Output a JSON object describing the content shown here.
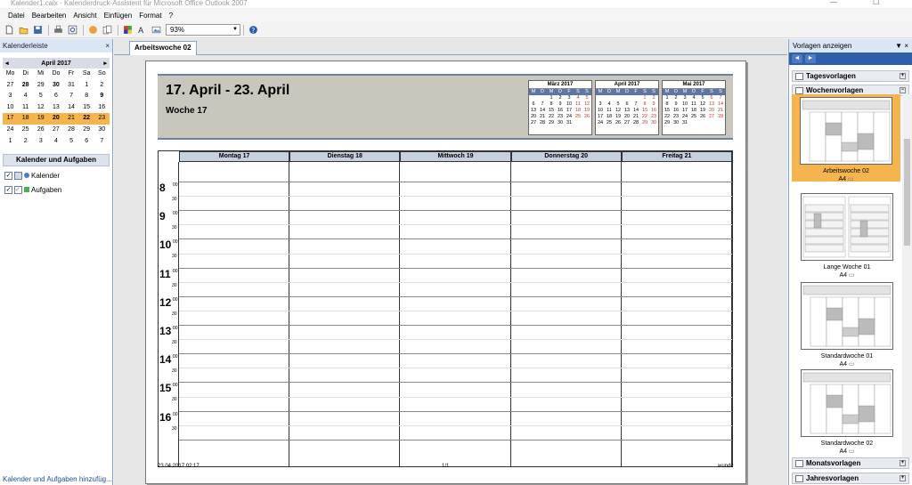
{
  "title": "Kalender1.calx - Kalenderdruck-Assistent für Microsoft Office Outlook 2007",
  "window_controls": {
    "minimize": "—",
    "maximize": "☐"
  },
  "menu": [
    "Datei",
    "Bearbeiten",
    "Ansicht",
    "Einfügen",
    "Format",
    "?"
  ],
  "toolbar": {
    "zoom": "93%"
  },
  "left_pane": {
    "title": "Kalenderleiste",
    "close": "×",
    "mini_cal": {
      "prev": "◂",
      "next": "▸",
      "month": "April 2017",
      "weekdays": [
        "Mo",
        "Di",
        "Mi",
        "Do",
        "Fr",
        "Sa",
        "So"
      ],
      "weeks": [
        [
          "27",
          "28",
          "29",
          "30",
          "31",
          "1",
          "2"
        ],
        [
          "3",
          "4",
          "5",
          "6",
          "7",
          "8",
          "9"
        ],
        [
          "10",
          "11",
          "12",
          "13",
          "14",
          "15",
          "16"
        ],
        [
          "17",
          "18",
          "19",
          "20",
          "21",
          "22",
          "23"
        ],
        [
          "24",
          "25",
          "26",
          "27",
          "28",
          "29",
          "30"
        ],
        [
          "1",
          "2",
          "3",
          "4",
          "5",
          "6",
          "7"
        ]
      ],
      "highlight_week": 3
    },
    "group_title": "Kalender und Aufgaben",
    "items": [
      {
        "label": "Kalender",
        "checked": true,
        "color": "#4a7bd0"
      },
      {
        "label": "Aufgaben",
        "checked": true,
        "color": "#4fae4f"
      }
    ],
    "footer_link": "Kalender und Aufgaben hinzufüg..."
  },
  "main": {
    "tab": "Arbeitswoche 02",
    "page": {
      "title": "17. April - 23. April",
      "subtitle": "Woche 17",
      "mini_months": [
        {
          "title": "März 2017",
          "header": [
            "M",
            "D",
            "M",
            "D",
            "F",
            "S",
            "S"
          ],
          "weeks": [
            [
              "",
              "",
              "1",
              "2",
              "3",
              "4",
              "5"
            ],
            [
              "6",
              "7",
              "8",
              "9",
              "10",
              "11",
              "12"
            ],
            [
              "13",
              "14",
              "15",
              "16",
              "17",
              "18",
              "19"
            ],
            [
              "20",
              "21",
              "22",
              "23",
              "24",
              "25",
              "26"
            ],
            [
              "27",
              "28",
              "29",
              "30",
              "31",
              "",
              ""
            ]
          ]
        },
        {
          "title": "April 2017",
          "header": [
            "M",
            "D",
            "M",
            "D",
            "F",
            "S",
            "S"
          ],
          "weeks": [
            [
              "",
              "",
              "",
              "",
              "",
              "1",
              "2"
            ],
            [
              "3",
              "4",
              "5",
              "6",
              "7",
              "8",
              "9"
            ],
            [
              "10",
              "11",
              "12",
              "13",
              "14",
              "15",
              "16"
            ],
            [
              "17",
              "18",
              "19",
              "20",
              "21",
              "22",
              "23"
            ],
            [
              "24",
              "25",
              "26",
              "27",
              "28",
              "29",
              "30"
            ]
          ]
        },
        {
          "title": "Mai 2017",
          "header": [
            "M",
            "D",
            "M",
            "D",
            "F",
            "S",
            "S"
          ],
          "weeks": [
            [
              "1",
              "2",
              "3",
              "4",
              "5",
              "6",
              "7"
            ],
            [
              "8",
              "9",
              "10",
              "11",
              "12",
              "13",
              "14"
            ],
            [
              "15",
              "16",
              "17",
              "18",
              "19",
              "20",
              "21"
            ],
            [
              "22",
              "23",
              "24",
              "25",
              "26",
              "27",
              "28"
            ],
            [
              "29",
              "30",
              "31",
              "",
              "",
              "",
              ""
            ]
          ]
        }
      ],
      "days": [
        "Montag 17",
        "Dienstag 18",
        "Mittwoch 19",
        "Donnerstag 20",
        "Freitag 21"
      ],
      "hours": [
        "8",
        "9",
        "10",
        "11",
        "12",
        "13",
        "14",
        "15",
        "16"
      ],
      "minute_top": "00",
      "minute_half": "30",
      "footer_left": "23.04.2017 02:17",
      "footer_center": "1/1",
      "footer_right": "wundc"
    }
  },
  "right_pane": {
    "title": "Vorlagen anzeigen",
    "nav_back": "◄",
    "nav_fwd": "►",
    "sections": [
      "Tagesvorlagen",
      "Wochenvorlagen",
      "Monatsvorlagen",
      "Jahresvorlagen"
    ],
    "templates": [
      {
        "name": "Arbeitswoche 02",
        "paper": "A4"
      },
      {
        "name": "Lange Woche 01",
        "paper": "A4"
      },
      {
        "name": "Standardwoche 01",
        "paper": "A4"
      },
      {
        "name": "Standardwoche 02",
        "paper": "A4"
      }
    ]
  }
}
